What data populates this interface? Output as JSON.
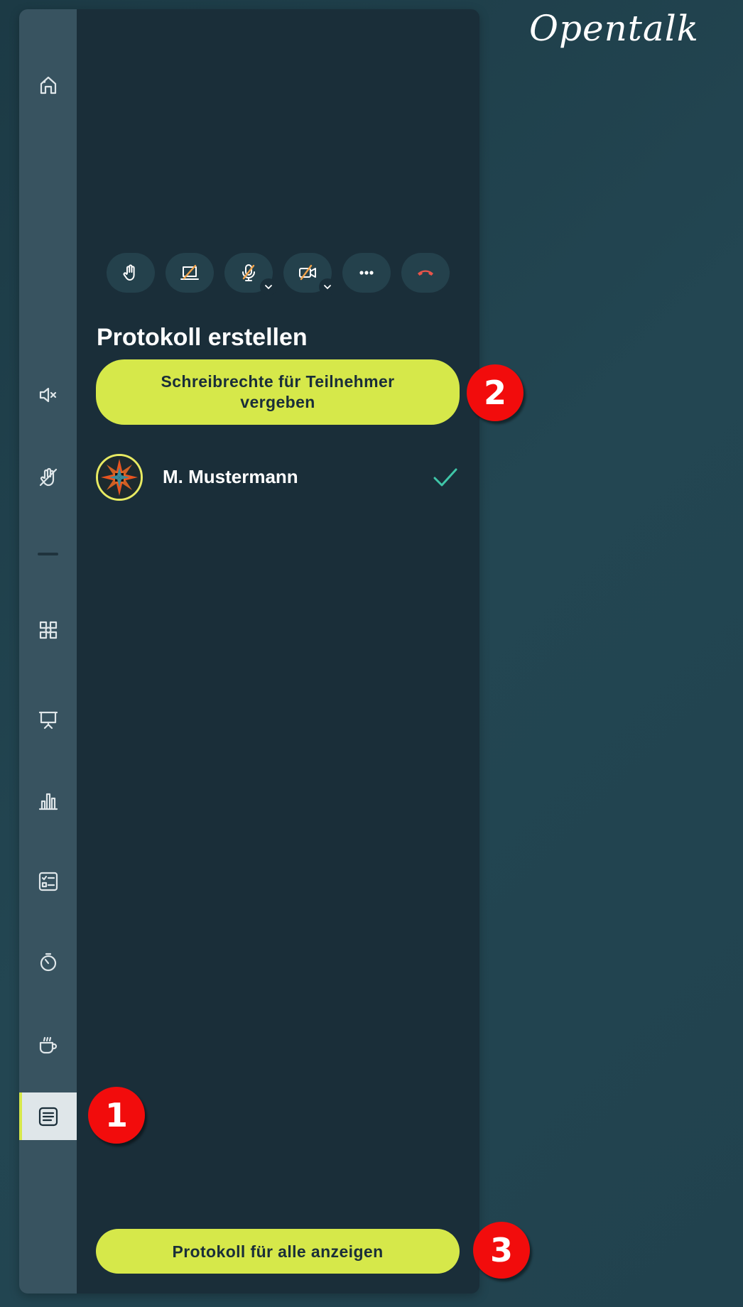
{
  "app": {
    "logo_text": "Opentalk"
  },
  "sidebar": {
    "icons": [
      "home-icon",
      "speaker-muted-icon",
      "muted-hand-icon",
      "breakout-rooms-icon",
      "presentation-icon",
      "poll-icon",
      "checklist-icon",
      "timer-icon",
      "coffee-break-icon",
      "protocol-icon"
    ],
    "active": "protocol-icon"
  },
  "toolbar": {
    "buttons": [
      "raise-hand-icon",
      "screen-share-off-icon",
      "microphone-off-icon",
      "camera-off-icon",
      "more-options-icon",
      "hang-up-icon"
    ]
  },
  "protocol": {
    "title": "Protokoll erstellen",
    "assign_rights_label": "Schreibrechte für Teilnehmer vergeben",
    "show_all_label": "Protokoll für alle anzeigen",
    "participants": [
      {
        "name": "M. Mustermann",
        "has_write_access": true
      }
    ]
  },
  "annotations": {
    "marker_1": "1",
    "marker_2": "2",
    "marker_3": "3"
  },
  "colors": {
    "accent": "#d6e84a",
    "panel": "#1a2e39",
    "rail": "#385360",
    "control_bg": "#24414c",
    "hangup": "#e8544a",
    "check": "#3fc6a8",
    "marker": "#f20c0c"
  }
}
